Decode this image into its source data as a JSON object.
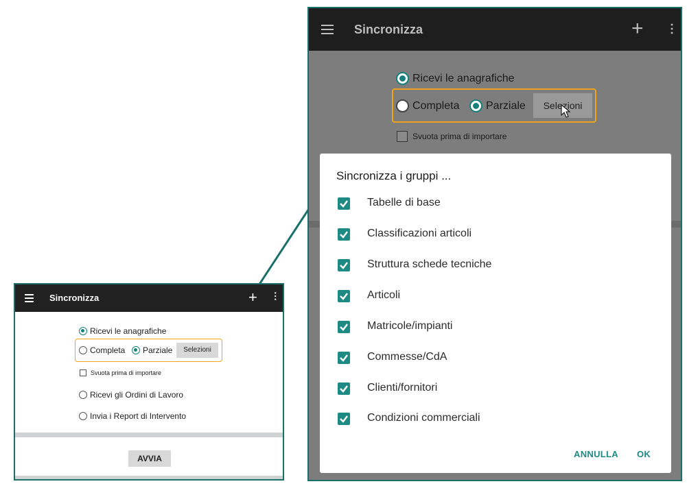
{
  "small_screen": {
    "app_title": "Sincronizza",
    "receive_registry": "Ricevi le anagrafiche",
    "mode_complete": "Completa",
    "mode_partial": "Parziale",
    "select_button": "Selezioni",
    "empty_before_import": "Svuota prima di importare",
    "receive_work_orders": "Ricevi gli Ordini di Lavoro",
    "send_reports": "Invia i Report di Intervento",
    "start_button": "AVVIA"
  },
  "big_screen": {
    "app_title": "Sincronizza",
    "receive_registry": "Ricevi le anagrafiche",
    "mode_complete": "Completa",
    "mode_partial": "Parziale",
    "select_button": "Selezioni",
    "empty_before_import": "Svuota prima di importare"
  },
  "dialog": {
    "title": "Sincronizza i gruppi ...",
    "items": [
      {
        "label": "Tabelle di base",
        "checked": true
      },
      {
        "label": "Classificazioni articoli",
        "checked": true
      },
      {
        "label": "Struttura schede tecniche",
        "checked": true
      },
      {
        "label": "Articoli",
        "checked": true
      },
      {
        "label": "Matricole/impianti",
        "checked": true
      },
      {
        "label": "Commesse/CdA",
        "checked": true
      },
      {
        "label": "Clienti/fornitori",
        "checked": true
      },
      {
        "label": "Condizioni commerciali",
        "checked": true
      }
    ],
    "cancel_button": "ANNULLA",
    "ok_button": "OK"
  },
  "colors": {
    "accent": "#1d8a83",
    "highlight_border": "#f1a31b",
    "arrow": "#1b6f6a",
    "appbar": "#212121"
  },
  "icons": [
    "menu-icon",
    "add-icon",
    "more-vert-icon",
    "checkbox-checked-icon",
    "cursor-icon"
  ]
}
